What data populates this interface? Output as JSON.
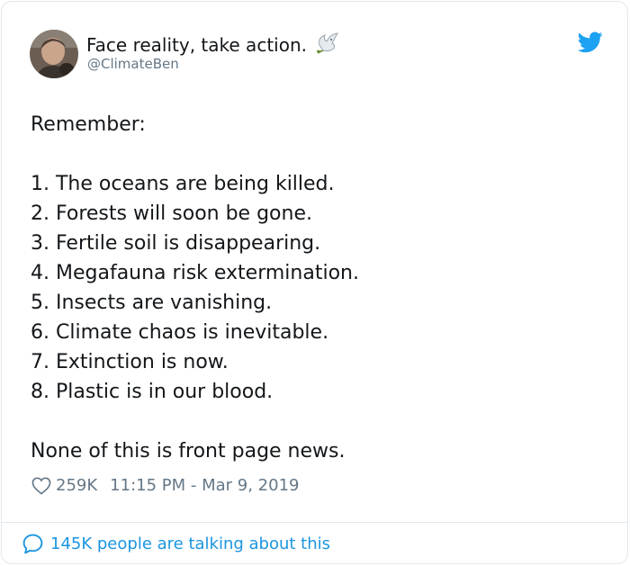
{
  "user": {
    "display_name": "Face reality, take action.",
    "handle": "@ClimateBen"
  },
  "tweet": {
    "intro": "Remember:",
    "items": [
      "1. The oceans are being killed.",
      "2. Forests will soon be gone.",
      "3. Fertile soil is disappearing.",
      "4. Megafauna risk extermination.",
      "5. Insects are vanishing.",
      "6. Climate chaos is inevitable.",
      "7. Extinction is now.",
      "8. Plastic is in our blood."
    ],
    "closing": "None of this is front page news."
  },
  "meta": {
    "likes": "259K",
    "timestamp": "11:15 PM - Mar 9, 2019"
  },
  "conversation": {
    "label": "145K people are talking about this"
  },
  "icons": {
    "brand": "twitter-bird-icon",
    "like": "heart-icon",
    "reply": "speech-bubble-icon",
    "emoji": "dove-icon"
  },
  "colors": {
    "brand": "#1da1f2",
    "link": "#1b95e0",
    "muted": "#657786",
    "text": "#14171a",
    "border": "#e1e8ed"
  }
}
